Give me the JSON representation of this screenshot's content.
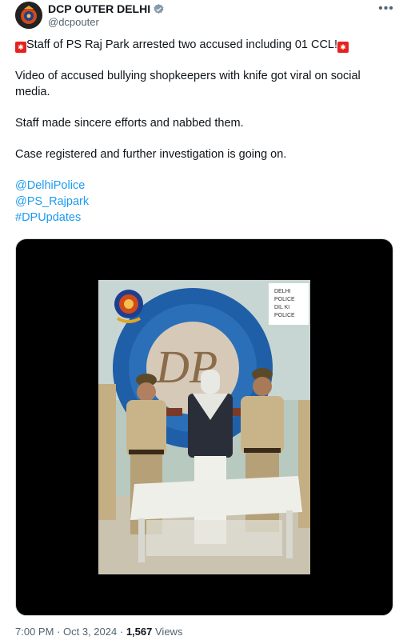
{
  "account": {
    "display_name": "DCP OUTER DELHI",
    "handle": "@dcpouter",
    "verified": true,
    "verified_color": "#829aab"
  },
  "tweet": {
    "headline_emoji": "police-light-emoji",
    "headline": "Staff of PS Raj Park arrested two accused including 01 CCL!",
    "para1": "Video of accused bullying shopkeepers with knife got viral on social media.",
    "para2": "Staff made sincere efforts and nabbed them.",
    "para3": "Case registered and further investigation is going on.",
    "mentions": [
      "@DelhiPolice",
      "@PS_Rajpark",
      "#DPUpdates"
    ]
  },
  "media": {
    "watermark_lines": [
      "DELHI",
      "POLICE",
      "DIL KI",
      "POLICE"
    ]
  },
  "meta": {
    "time": "7:00 PM",
    "date": "Oct 3, 2024",
    "views_count": "1,567",
    "views_label": "Views"
  },
  "colors": {
    "link": "#1d9bf0",
    "muted": "#536471",
    "text": "#0f1419"
  }
}
